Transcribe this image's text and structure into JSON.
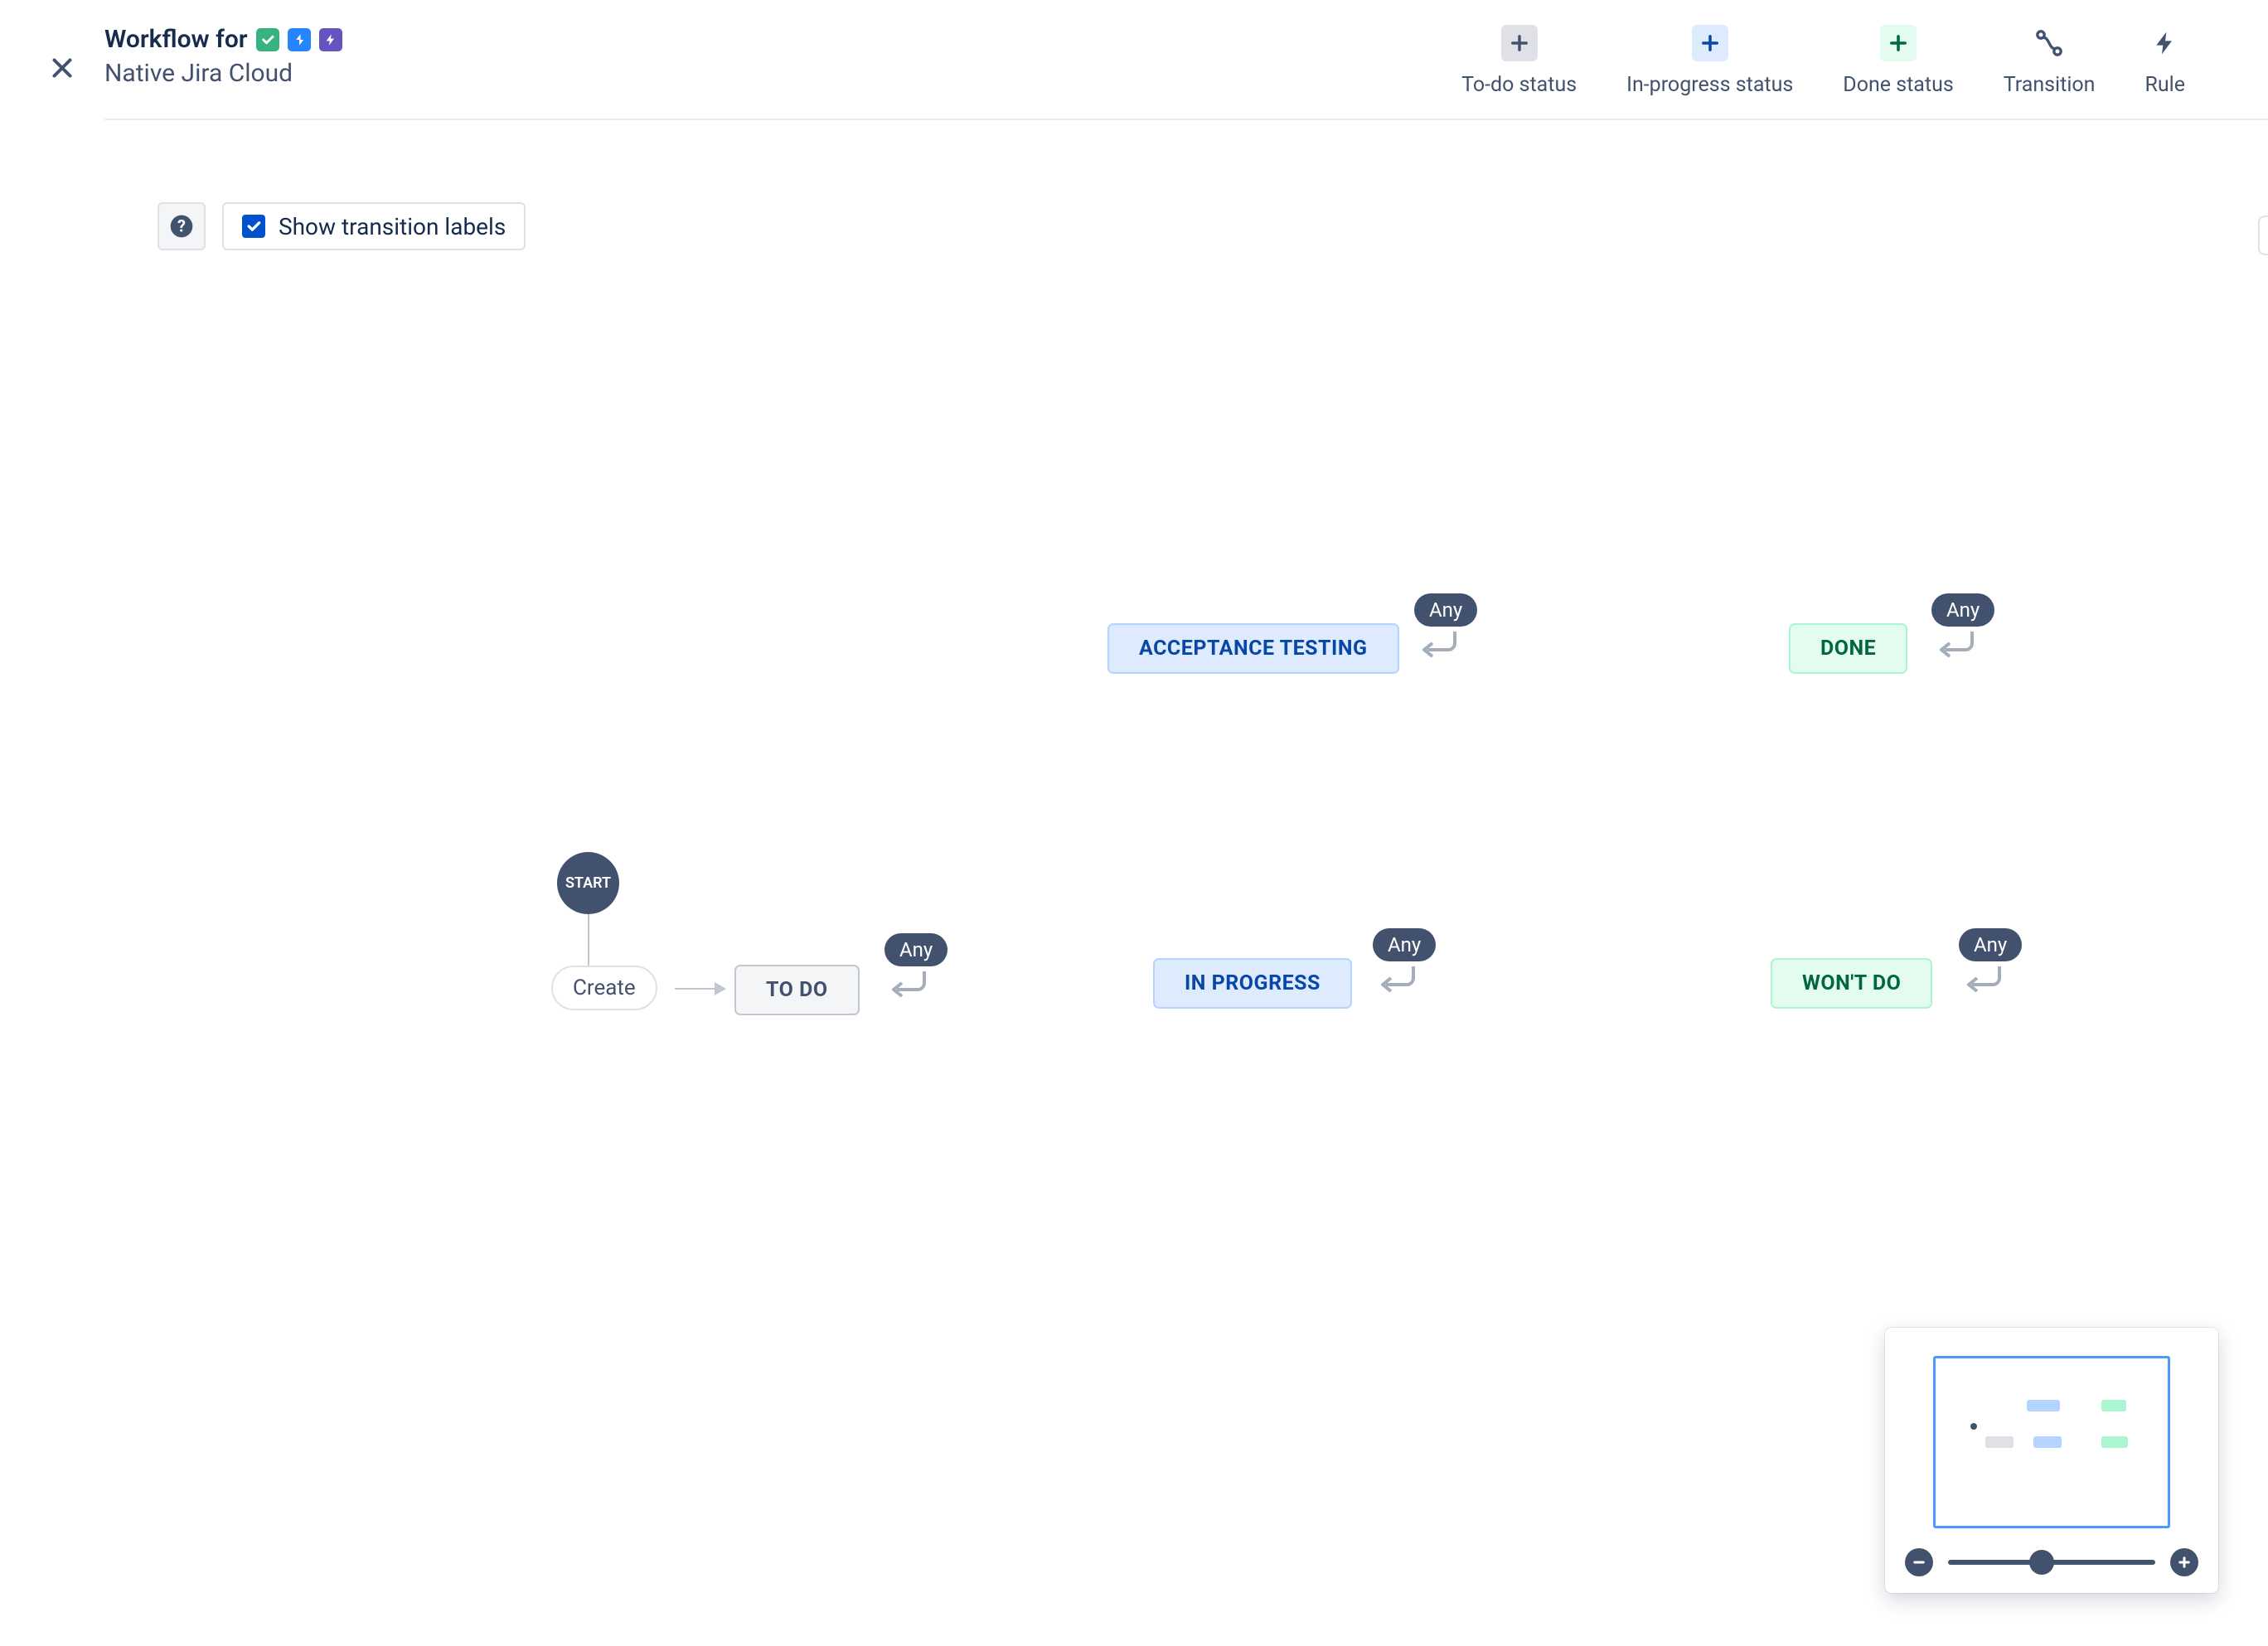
{
  "header": {
    "title": "Workflow for",
    "subtitle": "Native Jira Cloud"
  },
  "toolbar": {
    "todo": "To-do status",
    "inprog": "In-progress status",
    "done": "Done status",
    "trans": "Transition",
    "rule": "Rule"
  },
  "subbar": {
    "show_labels": "Show transition labels",
    "checked": true
  },
  "workflow": {
    "start": "START",
    "create": "Create",
    "any": "Any",
    "statuses": {
      "todo": {
        "label": "TO DO",
        "kind": "todo"
      },
      "accept": {
        "label": "ACCEPTANCE TESTING",
        "kind": "inprog"
      },
      "inprogress": {
        "label": "IN PROGRESS",
        "kind": "inprog"
      },
      "done": {
        "label": "DONE",
        "kind": "done"
      },
      "wontdo": {
        "label": "WON'T DO",
        "kind": "done"
      }
    }
  },
  "colors": {
    "todo_bg": "#F4F5F7",
    "todo_border": "#C1C7D0",
    "todo_fg": "#42526E",
    "inprog_bg": "#DEEBFF",
    "inprog_border": "#B3D4FF",
    "inprog_fg": "#0747A6",
    "done_bg": "#E3FCEF",
    "done_border": "#ABF5D1",
    "done_fg": "#006644",
    "brand_blue": "#0052CC"
  },
  "zoom": {
    "percent": 45
  }
}
